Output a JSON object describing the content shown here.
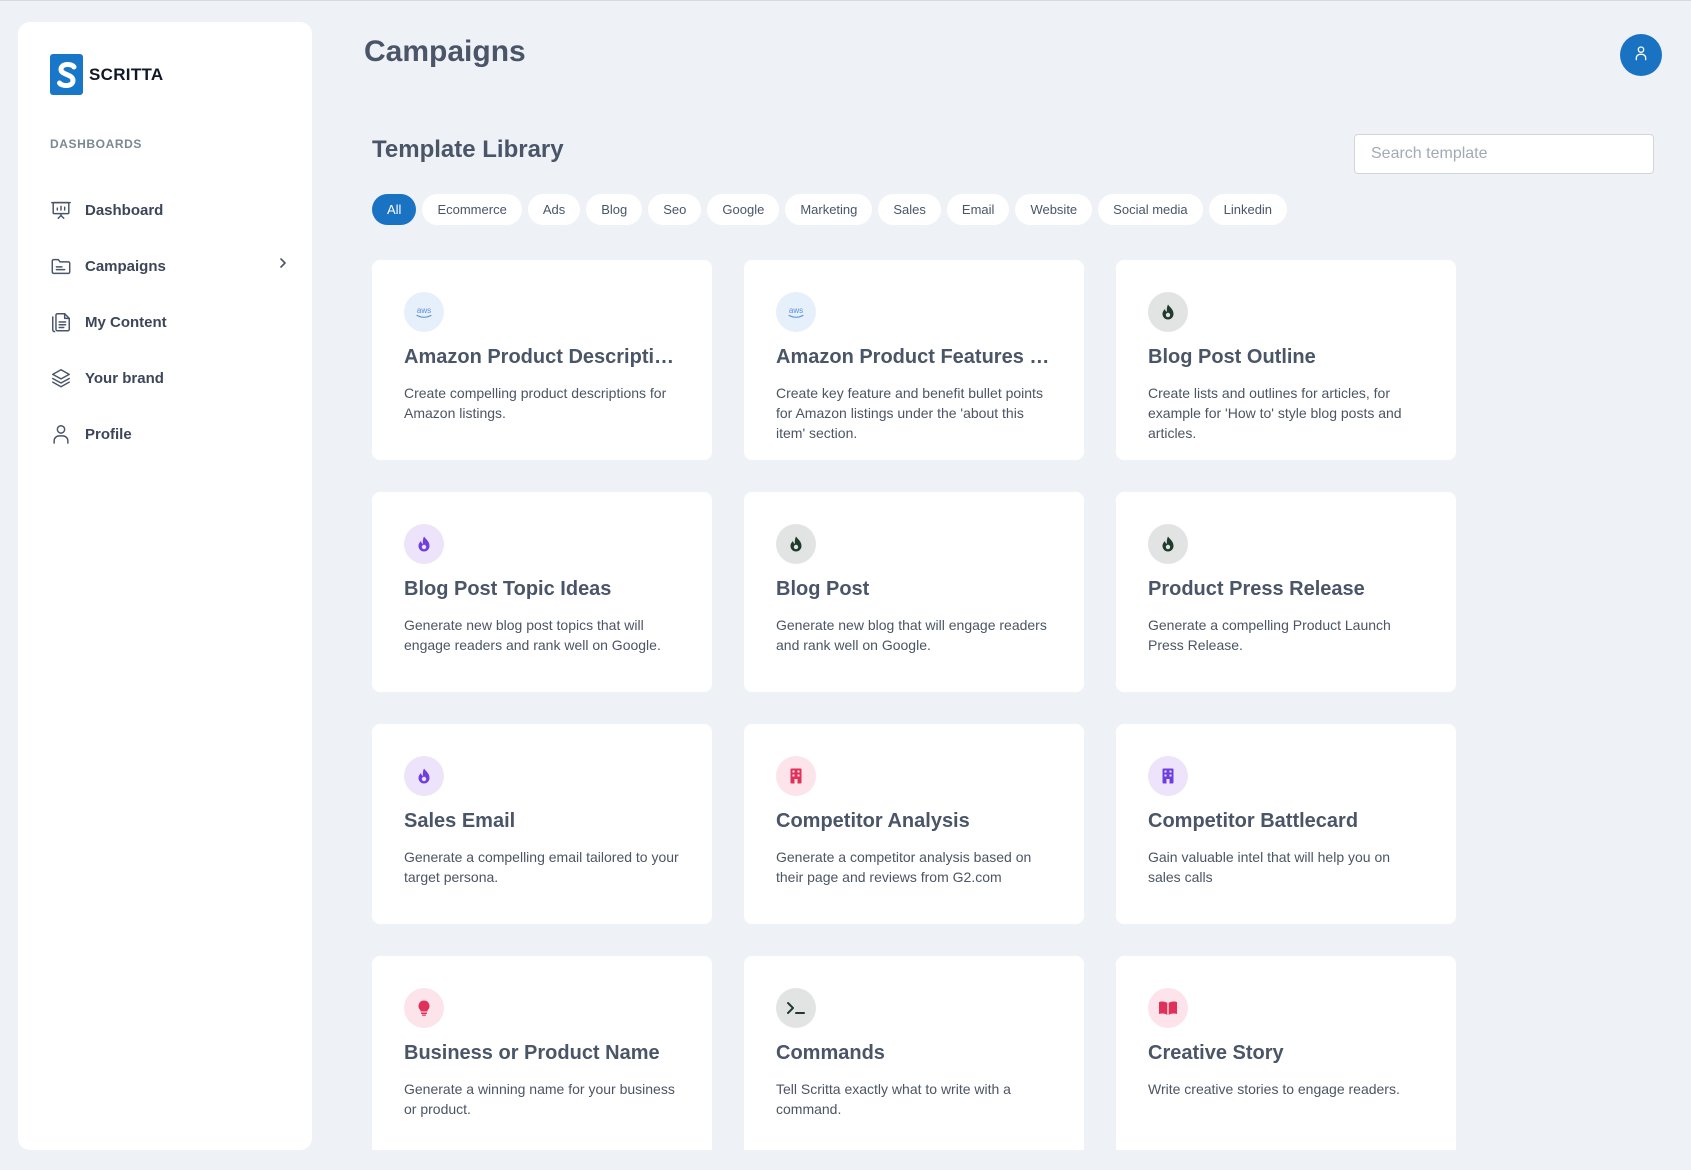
{
  "brand": {
    "name": "SCRITTA"
  },
  "sidebar": {
    "section_label": "DASHBOARDS",
    "items": [
      {
        "label": "Dashboard",
        "icon": "presentation-chart-icon"
      },
      {
        "label": "Campaigns",
        "icon": "folder-icon"
      },
      {
        "label": "My Content",
        "icon": "documents-icon"
      },
      {
        "label": "Your brand",
        "icon": "layers-icon"
      },
      {
        "label": "Profile",
        "icon": "user-icon"
      }
    ]
  },
  "header": {
    "title": "Campaigns"
  },
  "library": {
    "title": "Template Library",
    "search_placeholder": "Search template",
    "filters": [
      "All",
      "Ecommerce",
      "Ads",
      "Blog",
      "Seo",
      "Google",
      "Marketing",
      "Sales",
      "Email",
      "Website",
      "Social media",
      "Linkedin"
    ],
    "active_filter": "All",
    "templates": [
      {
        "title": "Amazon Product Descriptio...",
        "description": "Create compelling product descriptions for Amazon listings.",
        "icon": "aws-icon"
      },
      {
        "title": "Amazon Product Features (...",
        "description": "Create key feature and benefit bullet points for Amazon listings under the 'about this item' section.",
        "icon": "aws-icon"
      },
      {
        "title": "Blog Post Outline",
        "description": "Create lists and outlines for articles, for example for 'How to' style blog posts and articles.",
        "icon": "fire-icon"
      },
      {
        "title": "Blog Post Topic Ideas",
        "description": "Generate new blog post topics that will engage readers and rank well on Google.",
        "icon": "fire-icon"
      },
      {
        "title": "Blog Post",
        "description": "Generate new blog that will engage readers and rank well on Google.",
        "icon": "fire-icon"
      },
      {
        "title": "Product Press Release",
        "description": "Generate a compelling Product Launch Press Release.",
        "icon": "fire-icon"
      },
      {
        "title": "Sales Email",
        "description": "Generate a compelling email tailored to your target persona.",
        "icon": "fire-icon"
      },
      {
        "title": "Competitor Analysis",
        "description": "Generate a competitor analysis based on their page and reviews from G2.com",
        "icon": "building-icon"
      },
      {
        "title": "Competitor Battlecard",
        "description": "Gain valuable intel that will help you on sales calls",
        "icon": "building-icon"
      },
      {
        "title": "Business or Product Name",
        "description": "Generate a winning name for your business or product.",
        "icon": "lightbulb-icon"
      },
      {
        "title": "Commands",
        "description": "Tell Scritta exactly what to write with a command.",
        "icon": "terminal-icon"
      },
      {
        "title": "Creative Story",
        "description": "Write creative stories to engage readers.",
        "icon": "book-icon"
      }
    ]
  },
  "colors": {
    "accent": "#1a73c2",
    "background": "#eef2f7",
    "icon_gray_bg": "#e2e4e3",
    "icon_purple_bg": "#ede4fb",
    "icon_pink_bg": "#fde4ea",
    "icon_blue_bg": "#e6f0fb"
  }
}
